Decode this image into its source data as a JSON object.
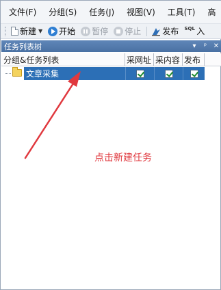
{
  "menubar": {
    "items": [
      "文件(F)",
      "分组(S)",
      "任务(J)",
      "视图(V)",
      "工具(T)",
      "高"
    ]
  },
  "toolbar": {
    "new_label": "新建",
    "start_label": "开始",
    "pause_label": "暂停",
    "stop_label": "停止",
    "publish_label": "发布",
    "sql_icon_text": "SQL",
    "sql_label": "入"
  },
  "panel": {
    "title": "任务列表树",
    "dropdown_glyph": "▾",
    "pin_glyph": "ᵖ",
    "close_glyph": "✕"
  },
  "columns": {
    "name": "分组&任务列表",
    "collect_url": "采网址",
    "collect_content": "采内容",
    "publish": "发布"
  },
  "tree": {
    "rows": [
      {
        "label": "文章采集",
        "collect_url": true,
        "collect_content": true,
        "publish": true
      }
    ]
  },
  "annotation": {
    "text": "点击新建任务",
    "color": "#e0383e"
  },
  "colors": {
    "selection": "#2c6fb6",
    "panel_title": "#4a71a3"
  }
}
